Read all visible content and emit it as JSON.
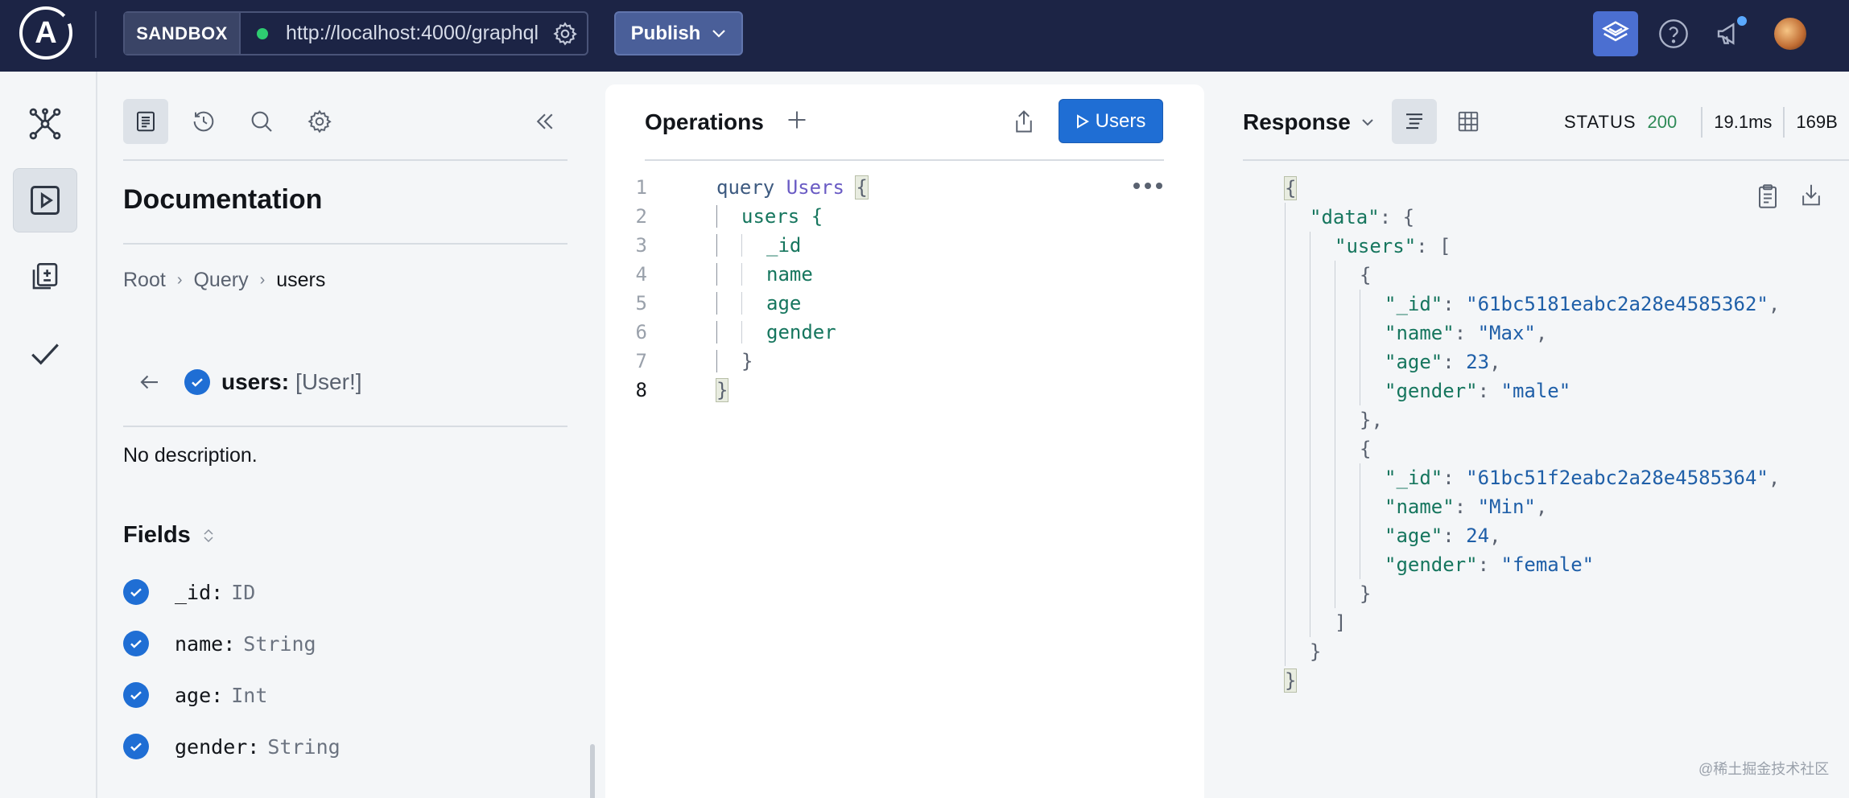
{
  "topbar": {
    "logo_letter": "A",
    "env_tag": "SANDBOX",
    "endpoint_url": "http://localhost:4000/graphql",
    "publish_label": "Publish",
    "icons": [
      "apollo-logo-icon",
      "settings-gear-icon",
      "studio-layers-icon",
      "help-icon",
      "announcement-megaphone-icon",
      "user-avatar"
    ]
  },
  "rail": {
    "items": [
      "schema-graph-icon",
      "explorer-play-icon",
      "checks-diff-icon",
      "checkmark-icon"
    ],
    "active": "explorer-play-icon"
  },
  "docs": {
    "tools": [
      "documentation-icon",
      "history-icon",
      "search-icon",
      "settings-gear-icon",
      "collapse-chevrons-icon"
    ],
    "title": "Documentation",
    "breadcrumb": [
      "Root",
      "Query",
      "users"
    ],
    "field_name": "users:",
    "field_type": "[User!]",
    "description": "No description.",
    "fields_title": "Fields",
    "fields": [
      {
        "name": "_id:",
        "type": "ID"
      },
      {
        "name": "name:",
        "type": "String"
      },
      {
        "name": "age:",
        "type": "Int"
      },
      {
        "name": "gender:",
        "type": "String"
      }
    ]
  },
  "operations": {
    "title": "Operations",
    "run_label": "Users",
    "lines": [
      {
        "n": "1",
        "kw": "query",
        "op": "Users",
        "brace": "{"
      },
      {
        "n": "2",
        "text": "users {"
      },
      {
        "n": "3",
        "text": "_id"
      },
      {
        "n": "4",
        "text": "name"
      },
      {
        "n": "5",
        "text": "age"
      },
      {
        "n": "6",
        "text": "gender"
      },
      {
        "n": "7",
        "text": "}"
      },
      {
        "n": "8",
        "text": "}"
      }
    ]
  },
  "response": {
    "title": "Response",
    "status_label": "STATUS",
    "status_code": "200",
    "time": "19.1ms",
    "size": "169B",
    "users": [
      {
        "_id": "\"61bc5181eabc2a28e4585362\"",
        "name": "\"Max\"",
        "age": "23",
        "gender": "\"male\""
      },
      {
        "_id": "\"61bc51f2eabc2a28e4585364\"",
        "name": "\"Min\"",
        "age": "24",
        "gender": "\"female\""
      }
    ]
  },
  "watermark": "@稀土掘金技术社区",
  "colors": {
    "topbar": "#1c2445",
    "accent": "#1f6ed4",
    "status_ok": "#2e8a57",
    "field_green": "#16765e"
  }
}
